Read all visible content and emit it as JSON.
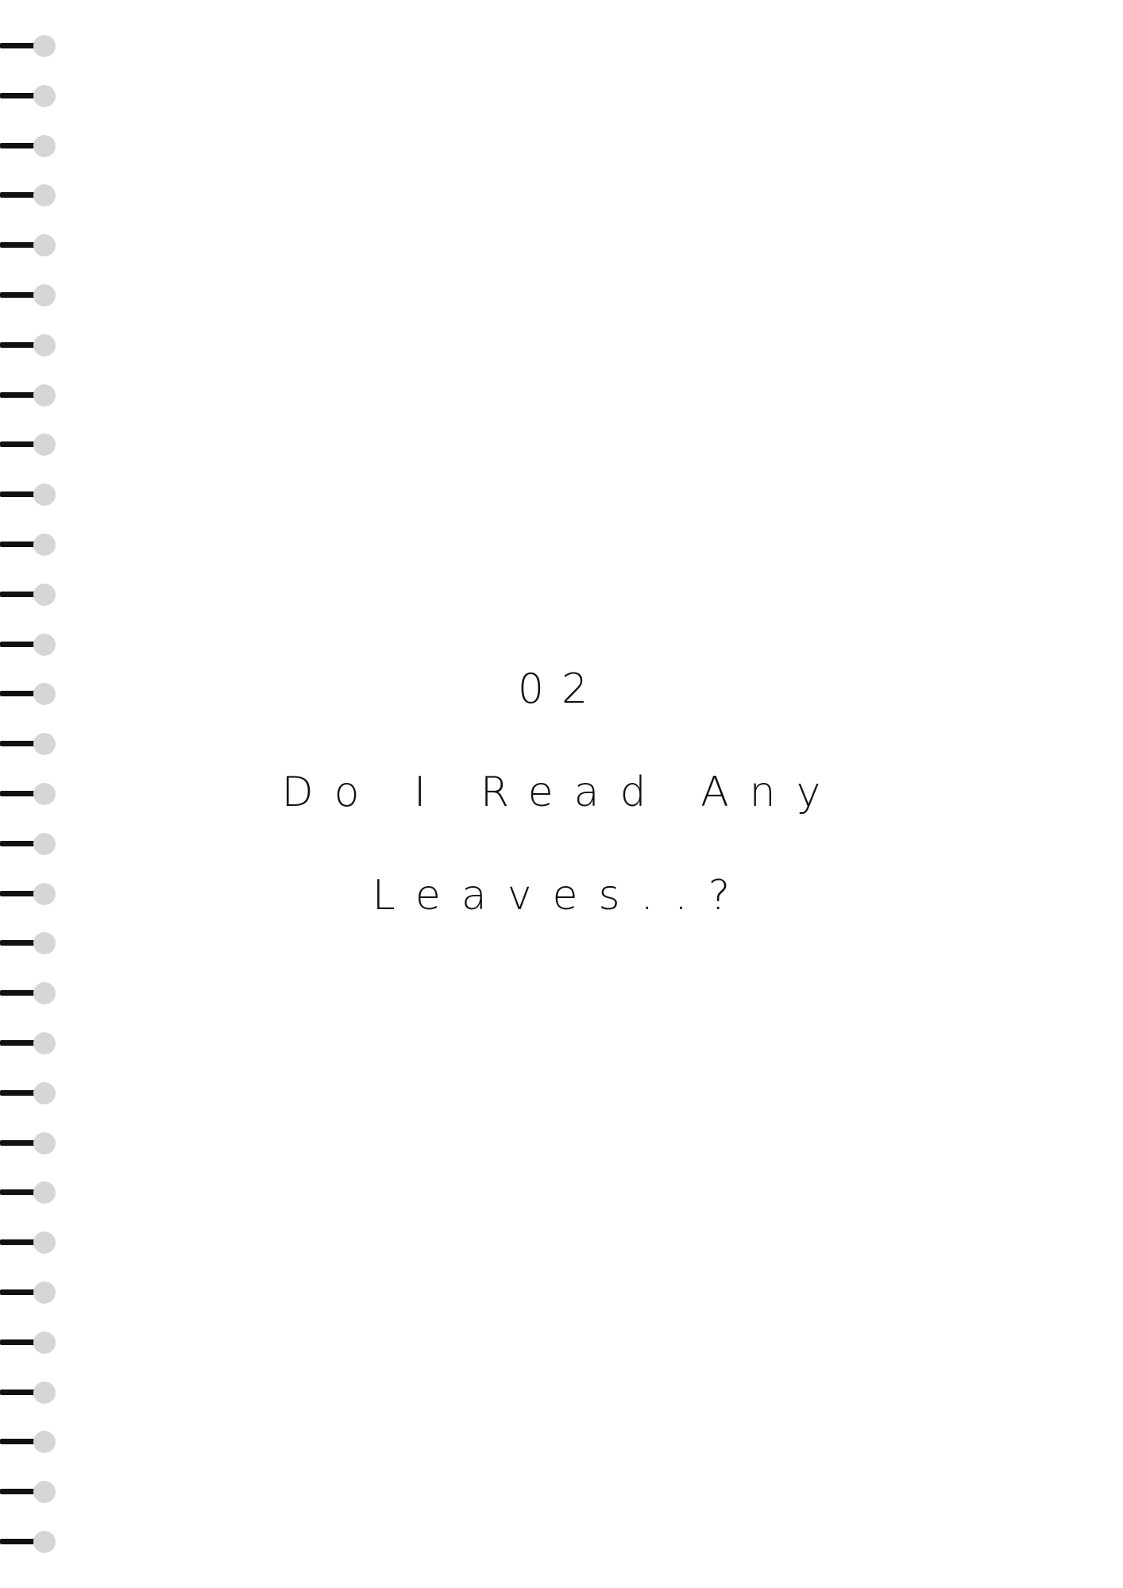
{
  "chapter": {
    "number": "02",
    "title_line_1": "Do I Read Any",
    "title_line_2": "Leaves..?"
  },
  "binding": {
    "ring_count": 31,
    "wire_color": "#111111",
    "hole_color": "#d6d6d6"
  }
}
